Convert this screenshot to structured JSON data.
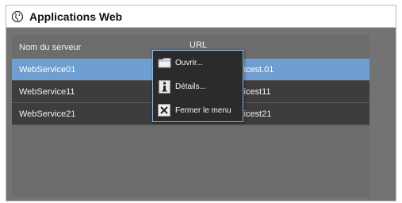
{
  "window": {
    "title": "Applications Web",
    "title_icon": "globe-icon"
  },
  "table": {
    "columns": [
      "Nom du serveur",
      "URL"
    ],
    "rows": [
      {
        "name": "WebService01",
        "url": "http://webservicest.01",
        "selected": true
      },
      {
        "name": "WebService11",
        "url": "http://webservicest11",
        "selected": false
      },
      {
        "name": "WebService21",
        "url": "http://webservicest21",
        "selected": false
      }
    ]
  },
  "context_menu": {
    "items": [
      {
        "label": "Ouvrir...",
        "icon": "folder-icon"
      },
      {
        "label": "Détails...",
        "icon": "info-icon"
      },
      {
        "label": "Fermer le menu",
        "icon": "close-icon"
      }
    ]
  },
  "colors": {
    "selected_row": "#6f9ed0",
    "row": "#3d3d3d",
    "panel": "#6c6c6c",
    "menu_border": "#8fb8e0"
  }
}
